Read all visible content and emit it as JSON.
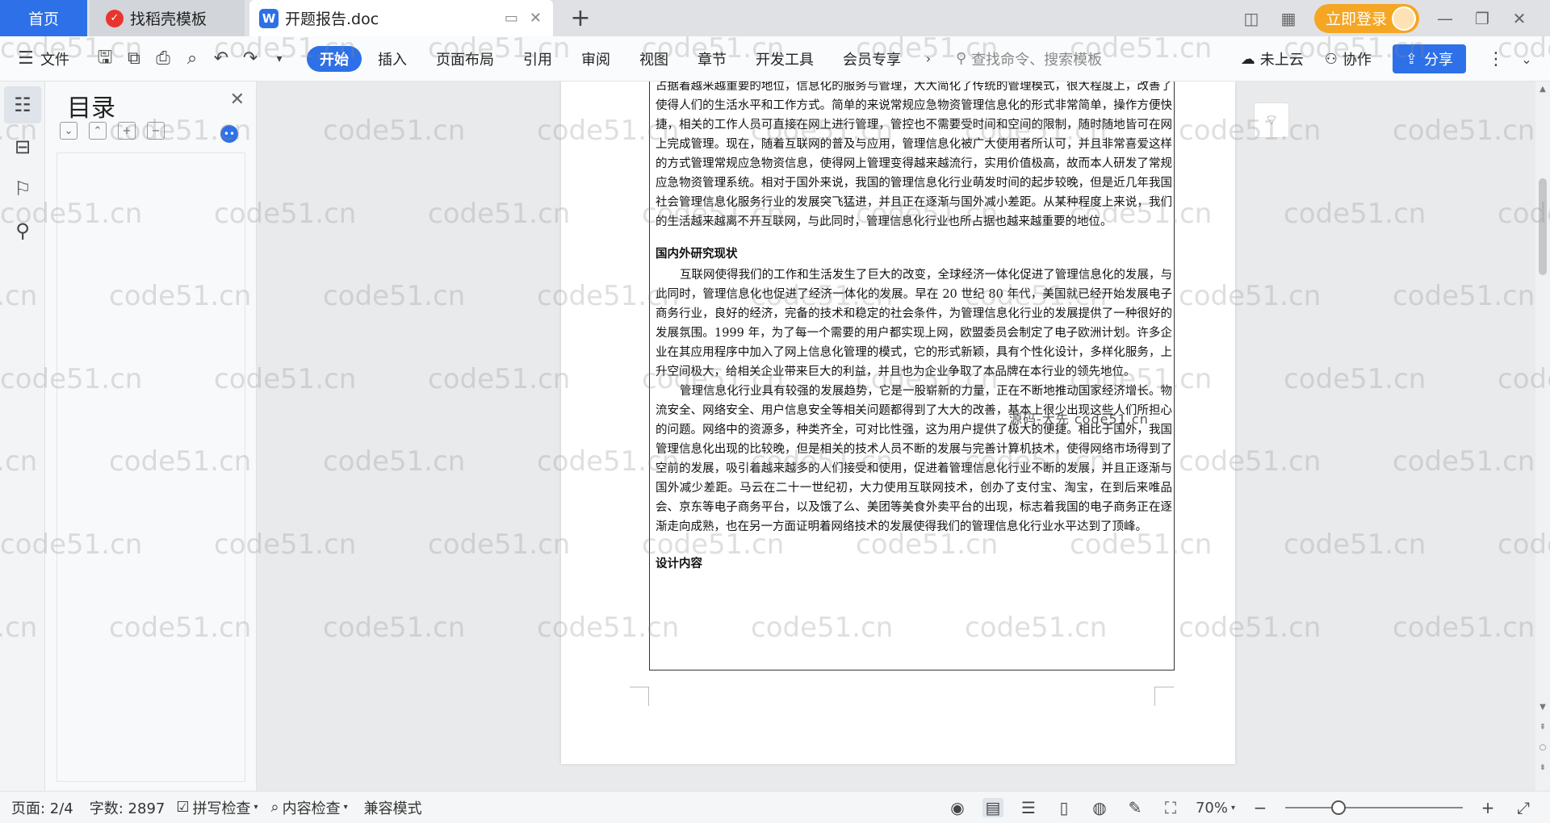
{
  "tabs": {
    "home": "首页",
    "template": "找稻壳模板",
    "doc": "开题报告.doc"
  },
  "header": {
    "login": "立即登录"
  },
  "ribbon": {
    "file": "文件",
    "menu": [
      "开始",
      "插入",
      "页面布局",
      "引用",
      "审阅",
      "视图",
      "章节",
      "开发工具",
      "会员专享"
    ],
    "search_placeholder": "查找命令、搜索模板",
    "cloud": "未上云",
    "collab": "协作",
    "share": "分享"
  },
  "toc": {
    "title": "目录"
  },
  "document": {
    "para1": "占据着越来越重要的地位，信息化的服务与管理，大大简化了传统的管理模式，很大程度上，改善了使得人们的生活水平和工作方式。简单的来说常规应急物资管理信息化的形式非常简单，操作方便快捷，相关的工作人员可直接在网上进行管理，管控也不需要受时间和空间的限制，随时随地皆可在网上完成管理。现在，随着互联网的普及与应用，管理信息化被广大使用者所认可，并且非常喜爱这样的方式管理常规应急物资信息，使得网上管理变得越来越流行，实用价值极高，故而本人研发了常规应急物资管理系统。相对于国外来说，我国的管理信息化行业萌发时间的起步较晚，但是近几年我国社会管理信息化服务行业的发展突飞猛进，并且正在逐渐与国外减小差距。从某种程度上来说，我们的生活越来越离不开互联网，与此同时，管理信息化行业也所占据也越来越重要的地位。",
    "heading1": "国内外研究现状",
    "para2": "互联网使得我们的工作和生活发生了巨大的改变，全球经济一体化促进了管理信息化的发展，与此同时，管理信息化也促进了经济一体化的发展。早在 20 世纪 80 年代，美国就已经开始发展电子商务行业，良好的经济，完备的技术和稳定的社会条件，为管理信息化行业的发展提供了一种很好的发展氛围。1999 年，为了每一个需要的用户都实现上网，欧盟委员会制定了电子欧洲计划。许多企业在其应用程序中加入了网上信息化管理的模式，它的形式新颖，具有个性化设计，多样化服务，上升空间极大，给相关企业带来巨大的利益，并且也为企业争取了本品牌在本行业的领先地位。",
    "para3": "管理信息化行业具有较强的发展趋势，它是一股崭新的力量，正在不断地推动国家经济增长。物流安全、网络安全、用户信息安全等相关问题都得到了大大的改善，基本上很少出现这些人们所担心的问题。网络中的资源多，种类齐全，可对比性强，这为用户提供了极大的便捷。相比于国外，我国管理信息化出现的比较晚，但是相关的技术人员不断的发展与完善计算机技术，使得网络市场得到了空前的发展，吸引着越来越多的人们接受和使用，促进着管理信息化行业不断的发展，并且正逐渐与国外减少差距。马云在二十一世纪初，大力使用互联网技术，创办了支付宝、淘宝，在到后来唯品会、京东等电子商务平台，以及饿了么、美团等美食外卖平台的出现，标志着我国的电子商务正在逐渐走向成熟，也在另一方面证明着网络技术的发展使得我们的管理信息化行业水平达到了顶峰。",
    "heading2": "设计内容",
    "stray": "源码-大先 code51.cn"
  },
  "status": {
    "page": "页面: 2/4",
    "words": "字数: 2897",
    "spell": "拼写检查",
    "content_check": "内容检查",
    "compat": "兼容模式",
    "zoom": "70%",
    "zoom_level": 0.3
  },
  "watermark": {
    "text": "code51.cn",
    "partial_right": "cod",
    "partial_left": "cn"
  },
  "colors": {
    "accent": "#2d70e8",
    "login": "#f5a623"
  }
}
